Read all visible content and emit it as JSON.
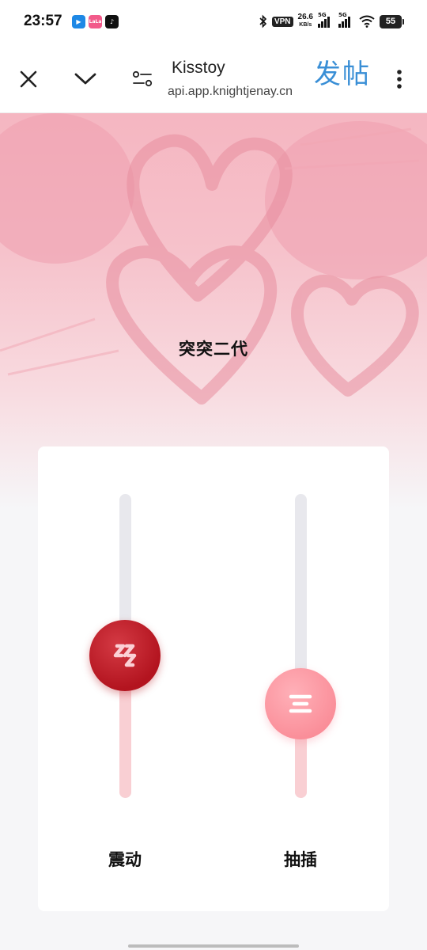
{
  "status_bar": {
    "time": "23:57",
    "app_icons": [
      {
        "name": "notification-app-blue-icon",
        "color": "#1e88e5",
        "glyph": "▶"
      },
      {
        "name": "notification-app-pink-icon",
        "color": "#f25a8a",
        "glyph": "LaLa"
      },
      {
        "name": "tiktok-icon",
        "color": "#111111",
        "glyph": "♪"
      }
    ],
    "vpn": "VPN",
    "net_speed_value": "26.6",
    "net_speed_unit": "KB/s",
    "signal_1_tag": "5G",
    "signal_2_tag": "5G",
    "battery": "55"
  },
  "nav": {
    "title": "Kisstoy",
    "url": "api.app.knightjenay.cn",
    "post_label": "发帖"
  },
  "device": {
    "name": "突突二代"
  },
  "controls": {
    "vibrate": {
      "label": "震动",
      "level": 0.47
    },
    "thrust": {
      "label": "抽插",
      "level": 0.31
    }
  },
  "colors": {
    "accent_blue": "#3a8fd6",
    "knob_vibrate": "#c01f2a",
    "knob_thrust": "#fb9aa4",
    "track_fill": "#f9cfd3",
    "track_bg": "#e8e8ed",
    "hero_pink": "#f5b6c1"
  }
}
